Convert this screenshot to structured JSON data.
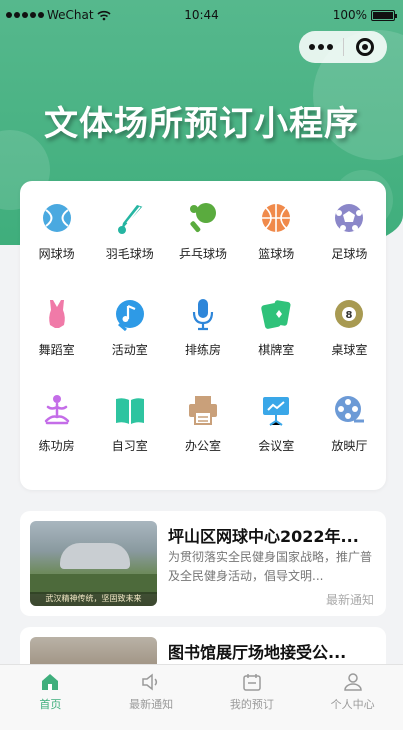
{
  "status": {
    "carrier": "WeChat",
    "time": "10:44",
    "battery": "100%"
  },
  "header": {
    "title": "文体场所预订小程序"
  },
  "venues": [
    {
      "label": "网球场",
      "icon": "tennis-ball-icon",
      "color": "#4aa9e0"
    },
    {
      "label": "羽毛球场",
      "icon": "shuttlecock-icon",
      "color": "#25b5a2"
    },
    {
      "label": "乒乓球场",
      "icon": "ping-pong-icon",
      "color": "#5aab3e"
    },
    {
      "label": "篮球场",
      "icon": "basketball-icon",
      "color": "#f08a4b"
    },
    {
      "label": "足球场",
      "icon": "football-icon",
      "color": "#8b87c9"
    },
    {
      "label": "舞蹈室",
      "icon": "leotard-icon",
      "color": "#f07aa8"
    },
    {
      "label": "活动室",
      "icon": "music-icon",
      "color": "#2e9ae6"
    },
    {
      "label": "排练房",
      "icon": "microphone-icon",
      "color": "#2e86d9"
    },
    {
      "label": "棋牌室",
      "icon": "cards-icon",
      "color": "#2fc27a"
    },
    {
      "label": "桌球室",
      "icon": "billiard-ball-icon",
      "color": "#a89a52"
    },
    {
      "label": "练功房",
      "icon": "yoga-icon",
      "color": "#c46de8"
    },
    {
      "label": "自习室",
      "icon": "book-icon",
      "color": "#2ec4a0"
    },
    {
      "label": "办公室",
      "icon": "printer-icon",
      "color": "#c9a07a"
    },
    {
      "label": "会议室",
      "icon": "presentation-icon",
      "color": "#3aa7e8"
    },
    {
      "label": "放映厅",
      "icon": "film-reel-icon",
      "color": "#6c9ad6"
    }
  ],
  "news": [
    {
      "title": "坪山区网球中心2022年...",
      "desc": "为贯彻落实全民健身国家战略，推广普及全民健身活动，倡导文明...",
      "tag": "最新通知",
      "image_caption": "武汉精神传统，坚固致未来"
    },
    {
      "title": "图书馆展厅场地接受公..."
    }
  ],
  "tabbar": [
    {
      "label": "首页",
      "icon": "home-icon",
      "active": true
    },
    {
      "label": "最新通知",
      "icon": "speaker-icon",
      "active": false
    },
    {
      "label": "我的预订",
      "icon": "calendar-icon",
      "active": false
    },
    {
      "label": "个人中心",
      "icon": "user-icon",
      "active": false
    }
  ],
  "colors": {
    "brand": "#3fae7c",
    "inactive_tab": "#9a9a9a"
  }
}
